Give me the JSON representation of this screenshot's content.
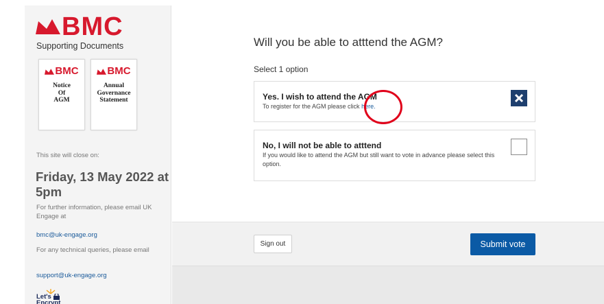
{
  "brand": {
    "logo_text": "BMC",
    "accent_color": "#d7192d"
  },
  "sidebar": {
    "supporting_heading": "Supporting Documents",
    "documents": [
      {
        "logo_text": "BMC",
        "title": "Notice\nOf\nAGM"
      },
      {
        "logo_text": "BMC",
        "title": "Annual\nGovernance\nStatement"
      }
    ],
    "close_label": "This site will close on:",
    "close_date": "Friday, 13 May 2022 at 5pm",
    "info_text": "For further information, please email UK Engage at",
    "info_email": "bmc@uk-engage.org",
    "tech_text": "For any technical queries, please email",
    "tech_email": "support@uk-engage.org",
    "badge_text": "Let's\nEncrypt"
  },
  "main": {
    "question": "Will you be able to atttend the AGM?",
    "select_hint": "Select 1 option",
    "options": [
      {
        "title": "Yes. I wish to attend the AGM",
        "desc_prefix": "To register for the AGM please click ",
        "link_text": "here.",
        "checked": true
      },
      {
        "title": "No, I will not be able to atttend",
        "desc": "If you would like to attend the AGM but still want to vote in advance please select this option.",
        "checked": false
      }
    ],
    "sign_out_label": "Sign out",
    "submit_label": "Submit vote",
    "submit_color": "#0b5aa5",
    "checkbox_color": "#1e3f6e",
    "annotation_color": "#e0001a"
  }
}
